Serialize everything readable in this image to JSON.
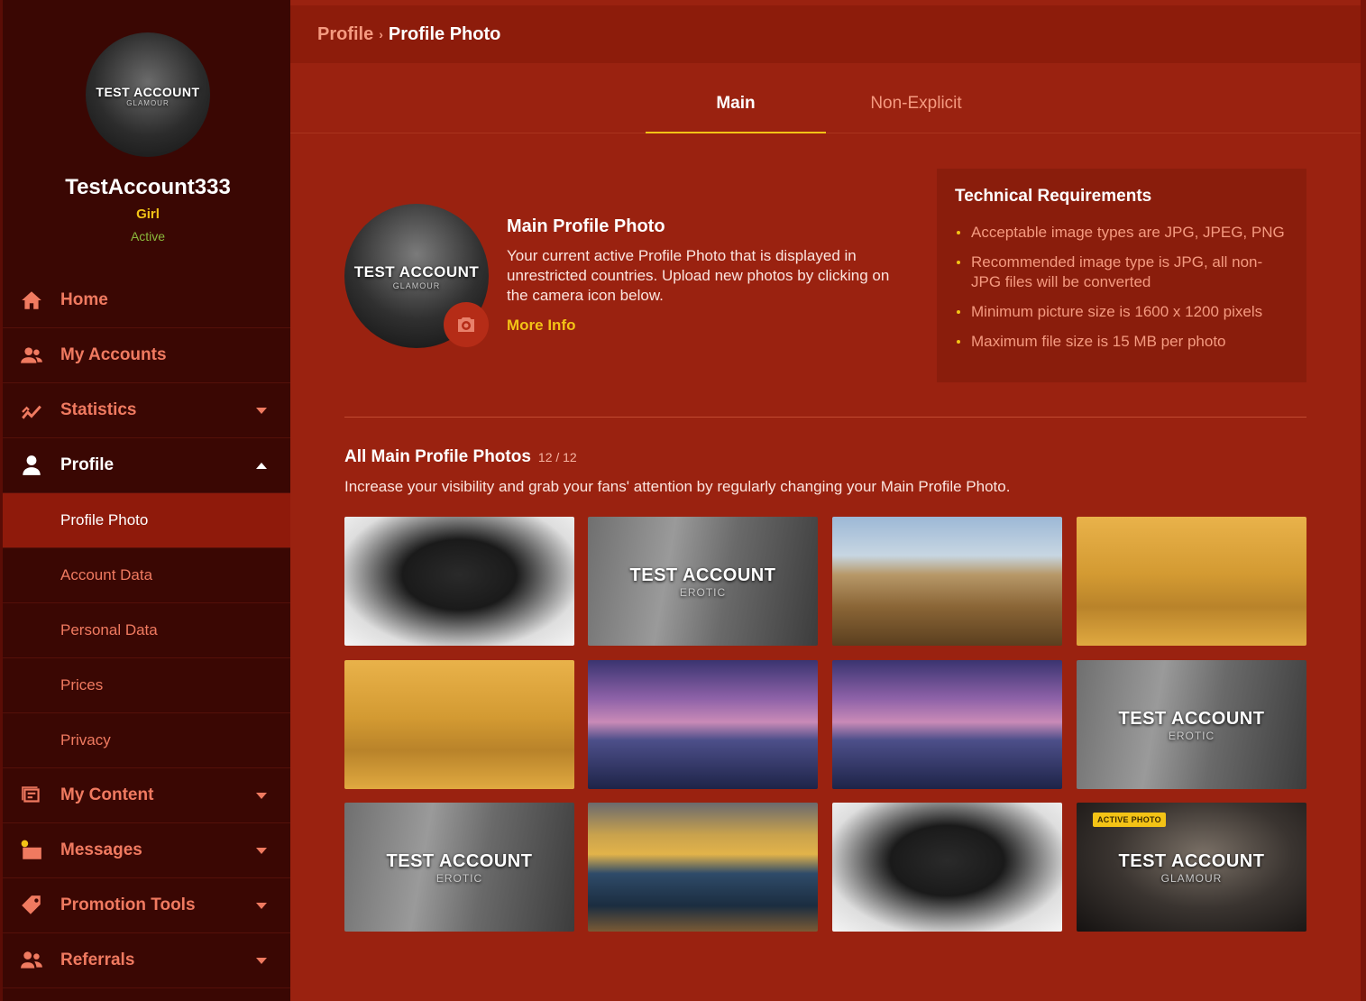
{
  "sidebar": {
    "avatar": {
      "watermark": "TEST ACCOUNT",
      "watermark_sub": "GLAMOUR"
    },
    "username": "TestAccount333",
    "gender": "Girl",
    "status": "Active",
    "nav": [
      {
        "label": "Home",
        "icon": "home-icon"
      },
      {
        "label": "My Accounts",
        "icon": "users-icon"
      },
      {
        "label": "Statistics",
        "icon": "chart-icon"
      },
      {
        "label": "Profile",
        "icon": "user-icon"
      },
      {
        "label": "My Content",
        "icon": "content-icon"
      },
      {
        "label": "Messages",
        "icon": "messages-icon"
      },
      {
        "label": "Promotion Tools",
        "icon": "tag-icon"
      },
      {
        "label": "Referrals",
        "icon": "referrals-icon"
      }
    ],
    "profile_sub": [
      "Profile Photo",
      "Account Data",
      "Personal Data",
      "Prices",
      "Privacy"
    ]
  },
  "breadcrumb": {
    "parent": "Profile",
    "separator": "›",
    "current": "Profile Photo"
  },
  "tabs": {
    "main": "Main",
    "non_explicit": "Non-Explicit"
  },
  "main_photo": {
    "title": "Main Profile Photo",
    "description": "Your current active Profile Photo that is displayed in unrestricted countries. Upload new photos by clicking on the camera icon below.",
    "more_info": "More Info",
    "watermark": "TEST ACCOUNT",
    "watermark_sub": "GLAMOUR"
  },
  "tech": {
    "title": "Technical Requirements",
    "items": [
      "Acceptable image types are JPG, JPEG, PNG",
      "Recommended image type is JPG, all non-JPG files will be converted",
      "Minimum picture size is 1600 x 1200 pixels",
      "Maximum file size is 15 MB per photo"
    ]
  },
  "all_photos": {
    "title": "All Main Profile Photos",
    "count": "12 / 12",
    "description": "Increase your visibility and grab your fans' attention by regularly changing your Main Profile Photo.",
    "active_badge": "ACTIVE PHOTO",
    "watermark": "TEST ACCOUNT",
    "erotic_sub": "EROTIC",
    "glamour_sub": "GLAMOUR"
  },
  "colors": {
    "accent": "#f3c316",
    "sidebar_bg": "#3a0703",
    "main_bg": "#9a2210",
    "link": "#f07a60"
  }
}
